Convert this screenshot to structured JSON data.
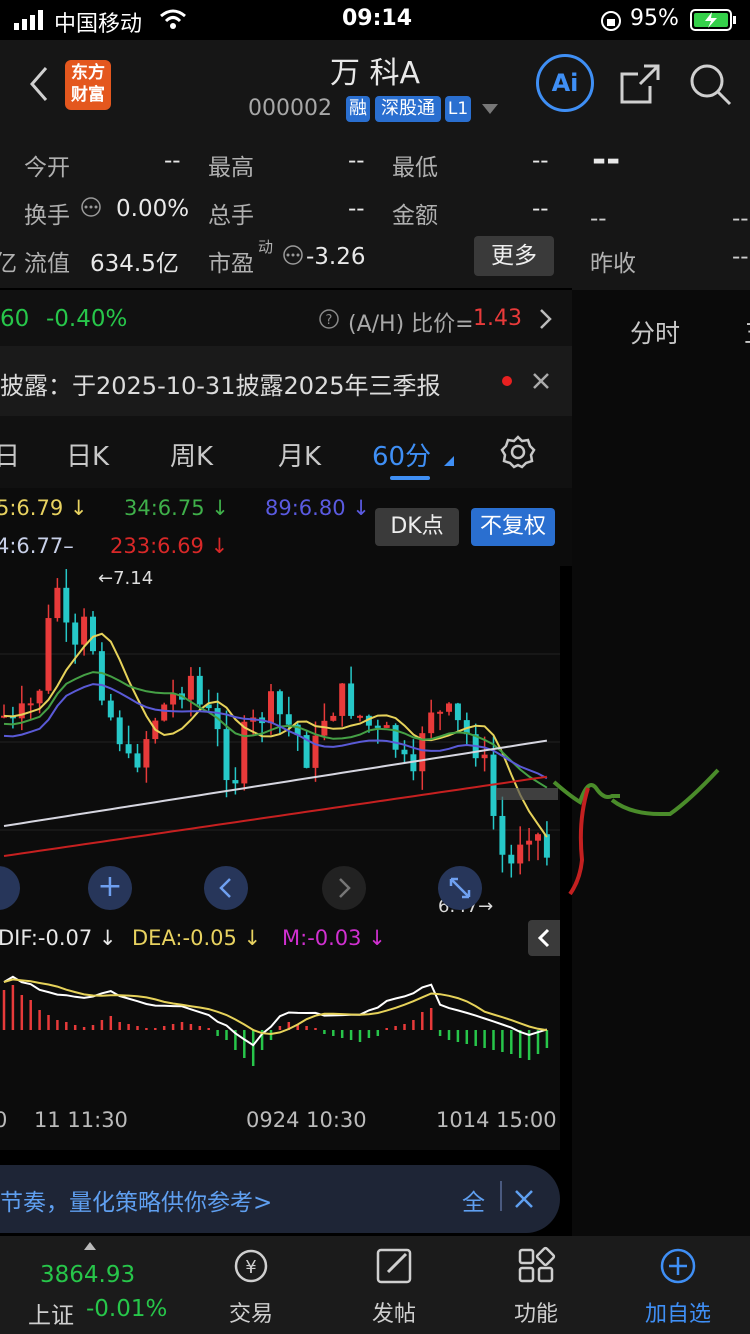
{
  "status_bar": {
    "carrier": "中国移动",
    "time": "09:14",
    "battery": "95%"
  },
  "nav": {
    "logo_line1": "东方",
    "logo_line2": "财富",
    "stock_name": "万 科A",
    "stock_code": "000002",
    "badge_rong": "融",
    "badge_sgt": "深股通",
    "badge_l1": "L1",
    "ai_label": "Ai"
  },
  "quote": {
    "open_label": "今开",
    "open_value": "--",
    "high_label": "最高",
    "high_value": "--",
    "low_label": "最低",
    "low_value": "--",
    "turnover_label": "换手",
    "turnover_value": "0.00%",
    "volume_label": "总手",
    "volume_value": "--",
    "amount_label": "金额",
    "amount_value": "--",
    "mktcap_label": "亿",
    "float_label": "流值",
    "float_value": "634.5亿",
    "pe_label": "市盈",
    "pe_sup": "动",
    "pe_value": "-3.26",
    "more_label": "更多"
  },
  "right_panel": {
    "price": "--",
    "value1": "--",
    "value2": "--",
    "prev_close_label": "昨收",
    "prev_close_value": "--",
    "tab_minute": "分时"
  },
  "ah": {
    "h_price": "60",
    "h_change": "-0.40%",
    "ratio_label": "(A/H) 比价=",
    "ratio_value": "1.43"
  },
  "notice": {
    "text": "披露：于2025-10-31披露2025年三季报"
  },
  "period_tabs": [
    "日",
    "日K",
    "周K",
    "月K",
    "60分"
  ],
  "ma": {
    "ma_5": "5:6.79",
    "ma_34": "34:6.75",
    "ma_89": "89:6.80",
    "ma_144": "4:6.77",
    "ma_233": "233:6.69",
    "dk_label": "DK点",
    "fq_label": "不复权"
  },
  "chart_labels": {
    "high_marker": "7.14",
    "low_marker": "6.47"
  },
  "macd": {
    "dif": "DIF:-0.07",
    "dea": "DEA:-0.05",
    "m": "M:-0.03"
  },
  "time_axis": [
    "0",
    "11 11:30",
    "0924 10:30",
    "1014 15:00"
  ],
  "tip": {
    "text": "节奏，量化策略供你参考>",
    "action": "全"
  },
  "tabbar": {
    "index_value": "3864.93",
    "index_name": "上证",
    "index_change": "-0.01%",
    "trade": "交易",
    "post": "发帖",
    "function": "功能",
    "add_watch": "加自选"
  },
  "colors": {
    "up": "#e83a3a",
    "down": "#26c8c8",
    "green": "#27c64a",
    "accent": "#3f8ff5",
    "ma5": "#e6e6e6",
    "ma34": "#45a045",
    "ma89": "#5a5ad6",
    "ma144": "#d6d6e0",
    "ma233": "#c62020"
  }
}
